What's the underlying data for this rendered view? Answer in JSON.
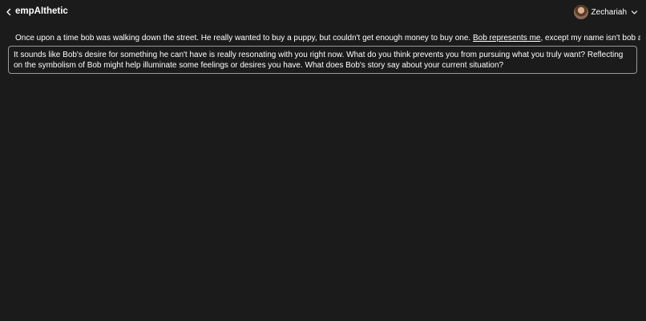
{
  "header": {
    "title": "empAIthetic",
    "user": {
      "name": "Zechariah"
    }
  },
  "icons": {
    "back": "chevron-left-icon",
    "user_menu": "chevron-down-icon",
    "avatar": "user-avatar"
  },
  "conversation": {
    "message": {
      "text_before_link": "Once upon a time bob was walking down the street. He really wanted to buy a puppy, but couldn't get enough money to buy one. ",
      "link_text": "Bob represents me",
      "text_after_link": ", except my name isn't bob and"
    },
    "response": "It sounds like Bob's desire for something he can't have is really resonating with you right now. What do you think prevents you from pursuing what you truly want? Reflecting on the symbolism of Bob might help illuminate some feelings or desires you have. What does Bob's story say about your current situation?"
  },
  "colors": {
    "background": "#1b1b1b",
    "text": "#ffffff",
    "border": "#9a9a9a"
  }
}
